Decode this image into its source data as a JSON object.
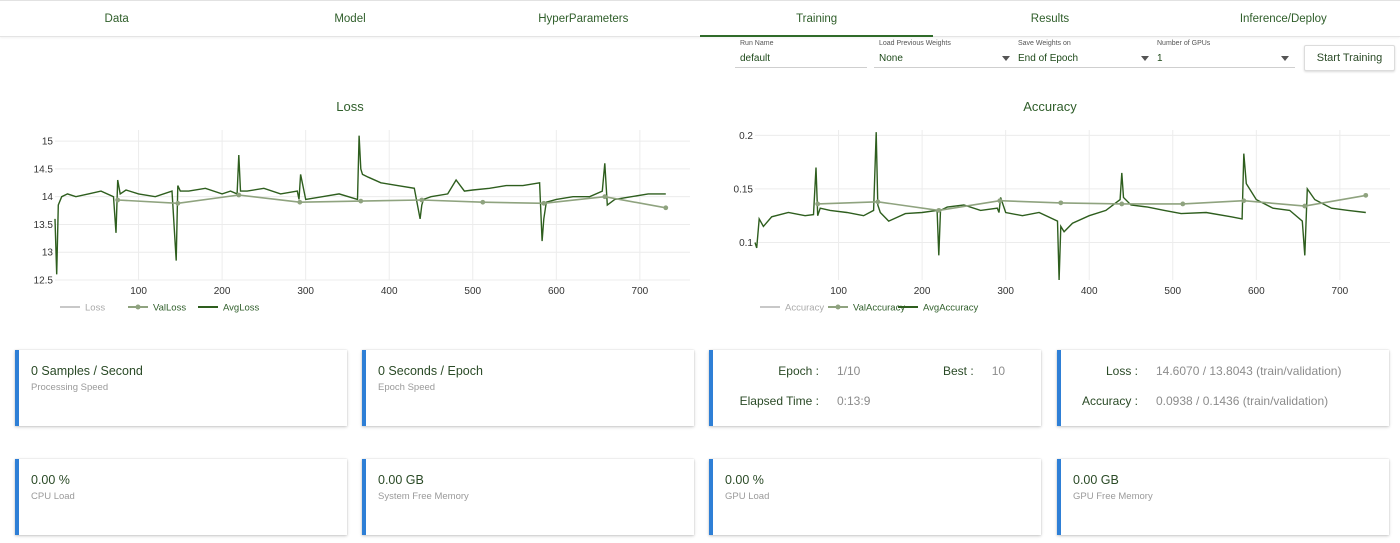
{
  "tabs": [
    "Data",
    "Model",
    "HyperParameters",
    "Training",
    "Results",
    "Inference/Deploy"
  ],
  "active_tab": 3,
  "controls": {
    "run_name": {
      "label": "Run Name",
      "value": "default"
    },
    "load_weights": {
      "label": "Load Previous Weights",
      "value": "None"
    },
    "save_weights": {
      "label": "Save Weights on",
      "value": "End of Epoch"
    },
    "num_gpus": {
      "label": "Number of GPUs",
      "value": "1"
    },
    "start_button": "Start Training"
  },
  "colors": {
    "accent": "#2f6b2a",
    "card_border": "#2e7fd6",
    "loss_line": "#c8c8c8",
    "val_line": "#8fa37f",
    "avg_line": "#2e5e1e"
  },
  "chart_data": [
    {
      "type": "line",
      "title": "Loss",
      "xlim": [
        0,
        760
      ],
      "ylim": [
        12.5,
        15.2
      ],
      "xticks": [
        100,
        200,
        300,
        400,
        500,
        600,
        700
      ],
      "yticks": [
        12.5,
        13,
        13.5,
        14,
        14.5,
        15
      ],
      "ytick_labels": [
        "12.5",
        "13",
        "13.5",
        "14",
        "14.5",
        "15"
      ],
      "legend": [
        "Loss",
        "ValLoss",
        "AvgLoss"
      ],
      "series": [
        {
          "name": "ValLoss",
          "x": [
            75,
            147,
            220,
            293,
            366,
            439,
            512,
            585,
            658,
            731
          ],
          "values": [
            13.94,
            13.88,
            14.03,
            13.9,
            13.92,
            13.94,
            13.9,
            13.88,
            14.0,
            13.8
          ]
        },
        {
          "name": "AvgLoss",
          "x": [
            0,
            2,
            4,
            8,
            15,
            25,
            40,
            55,
            70,
            73,
            75,
            78,
            85,
            100,
            120,
            140,
            145,
            147,
            150,
            160,
            180,
            200,
            210,
            218,
            220,
            222,
            230,
            250,
            270,
            290,
            292,
            294,
            300,
            320,
            340,
            362,
            364,
            366,
            368,
            375,
            390,
            410,
            430,
            437,
            439,
            441,
            450,
            470,
            480,
            490,
            500,
            520,
            540,
            560,
            580,
            583,
            585,
            588,
            600,
            620,
            640,
            655,
            658,
            661,
            670,
            690,
            710,
            731
          ],
          "values": [
            13.6,
            12.6,
            13.85,
            14.0,
            14.05,
            14.0,
            14.05,
            14.1,
            14.0,
            13.35,
            14.3,
            14.05,
            14.12,
            14.05,
            14.0,
            14.1,
            12.85,
            14.2,
            14.1,
            14.1,
            14.15,
            14.05,
            14.1,
            14.05,
            14.75,
            14.1,
            14.1,
            14.15,
            14.05,
            14.1,
            13.95,
            14.4,
            13.95,
            14.0,
            14.05,
            13.95,
            15.1,
            14.5,
            14.4,
            14.35,
            14.25,
            14.2,
            14.15,
            13.6,
            13.85,
            13.95,
            14.0,
            14.05,
            14.3,
            14.1,
            14.12,
            14.15,
            14.2,
            14.2,
            14.25,
            13.2,
            13.6,
            13.9,
            13.95,
            14.0,
            14.0,
            14.1,
            14.6,
            13.85,
            13.95,
            14.0,
            14.05,
            14.05
          ]
        }
      ]
    },
    {
      "type": "line",
      "title": "Accuracy",
      "xlim": [
        0,
        760
      ],
      "ylim": [
        0.065,
        0.205
      ],
      "xticks": [
        100,
        200,
        300,
        400,
        500,
        600,
        700
      ],
      "yticks": [
        0.1,
        0.15,
        0.2
      ],
      "ytick_labels": [
        "0.1",
        "0.15",
        "0.2"
      ],
      "legend": [
        "Accuracy",
        "ValAccuracy",
        "AvgAccuracy"
      ],
      "series": [
        {
          "name": "ValAccuracy",
          "x": [
            75,
            147,
            220,
            293,
            366,
            439,
            512,
            585,
            658,
            731
          ],
          "values": [
            0.136,
            0.138,
            0.13,
            0.139,
            0.137,
            0.136,
            0.136,
            0.139,
            0.134,
            0.144
          ]
        },
        {
          "name": "AvgAccuracy",
          "x": [
            0,
            2,
            5,
            10,
            20,
            40,
            60,
            70,
            73,
            75,
            78,
            90,
            110,
            130,
            142,
            145,
            147,
            150,
            160,
            180,
            200,
            218,
            220,
            222,
            230,
            250,
            270,
            290,
            292,
            294,
            300,
            320,
            340,
            362,
            364,
            366,
            370,
            380,
            400,
            420,
            437,
            439,
            441,
            450,
            470,
            490,
            510,
            540,
            570,
            583,
            585,
            588,
            600,
            620,
            640,
            655,
            658,
            661,
            670,
            690,
            710,
            731
          ],
          "values": [
            0.1,
            0.095,
            0.122,
            0.115,
            0.124,
            0.128,
            0.125,
            0.126,
            0.17,
            0.125,
            0.132,
            0.13,
            0.128,
            0.125,
            0.13,
            0.203,
            0.135,
            0.128,
            0.12,
            0.127,
            0.128,
            0.13,
            0.088,
            0.13,
            0.133,
            0.135,
            0.13,
            0.132,
            0.128,
            0.142,
            0.128,
            0.125,
            0.128,
            0.12,
            0.065,
            0.115,
            0.11,
            0.118,
            0.125,
            0.13,
            0.14,
            0.165,
            0.142,
            0.135,
            0.133,
            0.13,
            0.127,
            0.128,
            0.124,
            0.122,
            0.183,
            0.155,
            0.14,
            0.132,
            0.13,
            0.12,
            0.088,
            0.15,
            0.14,
            0.132,
            0.13,
            0.128
          ]
        }
      ]
    }
  ],
  "cards": {
    "processing": {
      "value": "0 Samples / Second",
      "label": "Processing Speed"
    },
    "epoch_speed": {
      "value": "0 Seconds / Epoch",
      "label": "Epoch Speed"
    },
    "epoch": {
      "epoch_label": "Epoch :",
      "epoch_value": "1/10",
      "best_label": "Best :",
      "best_value": "10",
      "elapsed_label": "Elapsed Time :",
      "elapsed_value": "0:13:9"
    },
    "metrics": {
      "loss_label": "Loss :",
      "loss_value": "14.6070 / 13.8043 (train/validation)",
      "acc_label": "Accuracy :",
      "acc_value": "0.0938 / 0.1436 (train/validation)"
    },
    "cpu": {
      "value": "0.00 %",
      "label": "CPU Load"
    },
    "sysmem": {
      "value": "0.00 GB",
      "label": "System Free Memory"
    },
    "gpu": {
      "value": "0.00 %",
      "label": "GPU Load"
    },
    "gpumem": {
      "value": "0.00 GB",
      "label": "GPU Free Memory"
    }
  }
}
